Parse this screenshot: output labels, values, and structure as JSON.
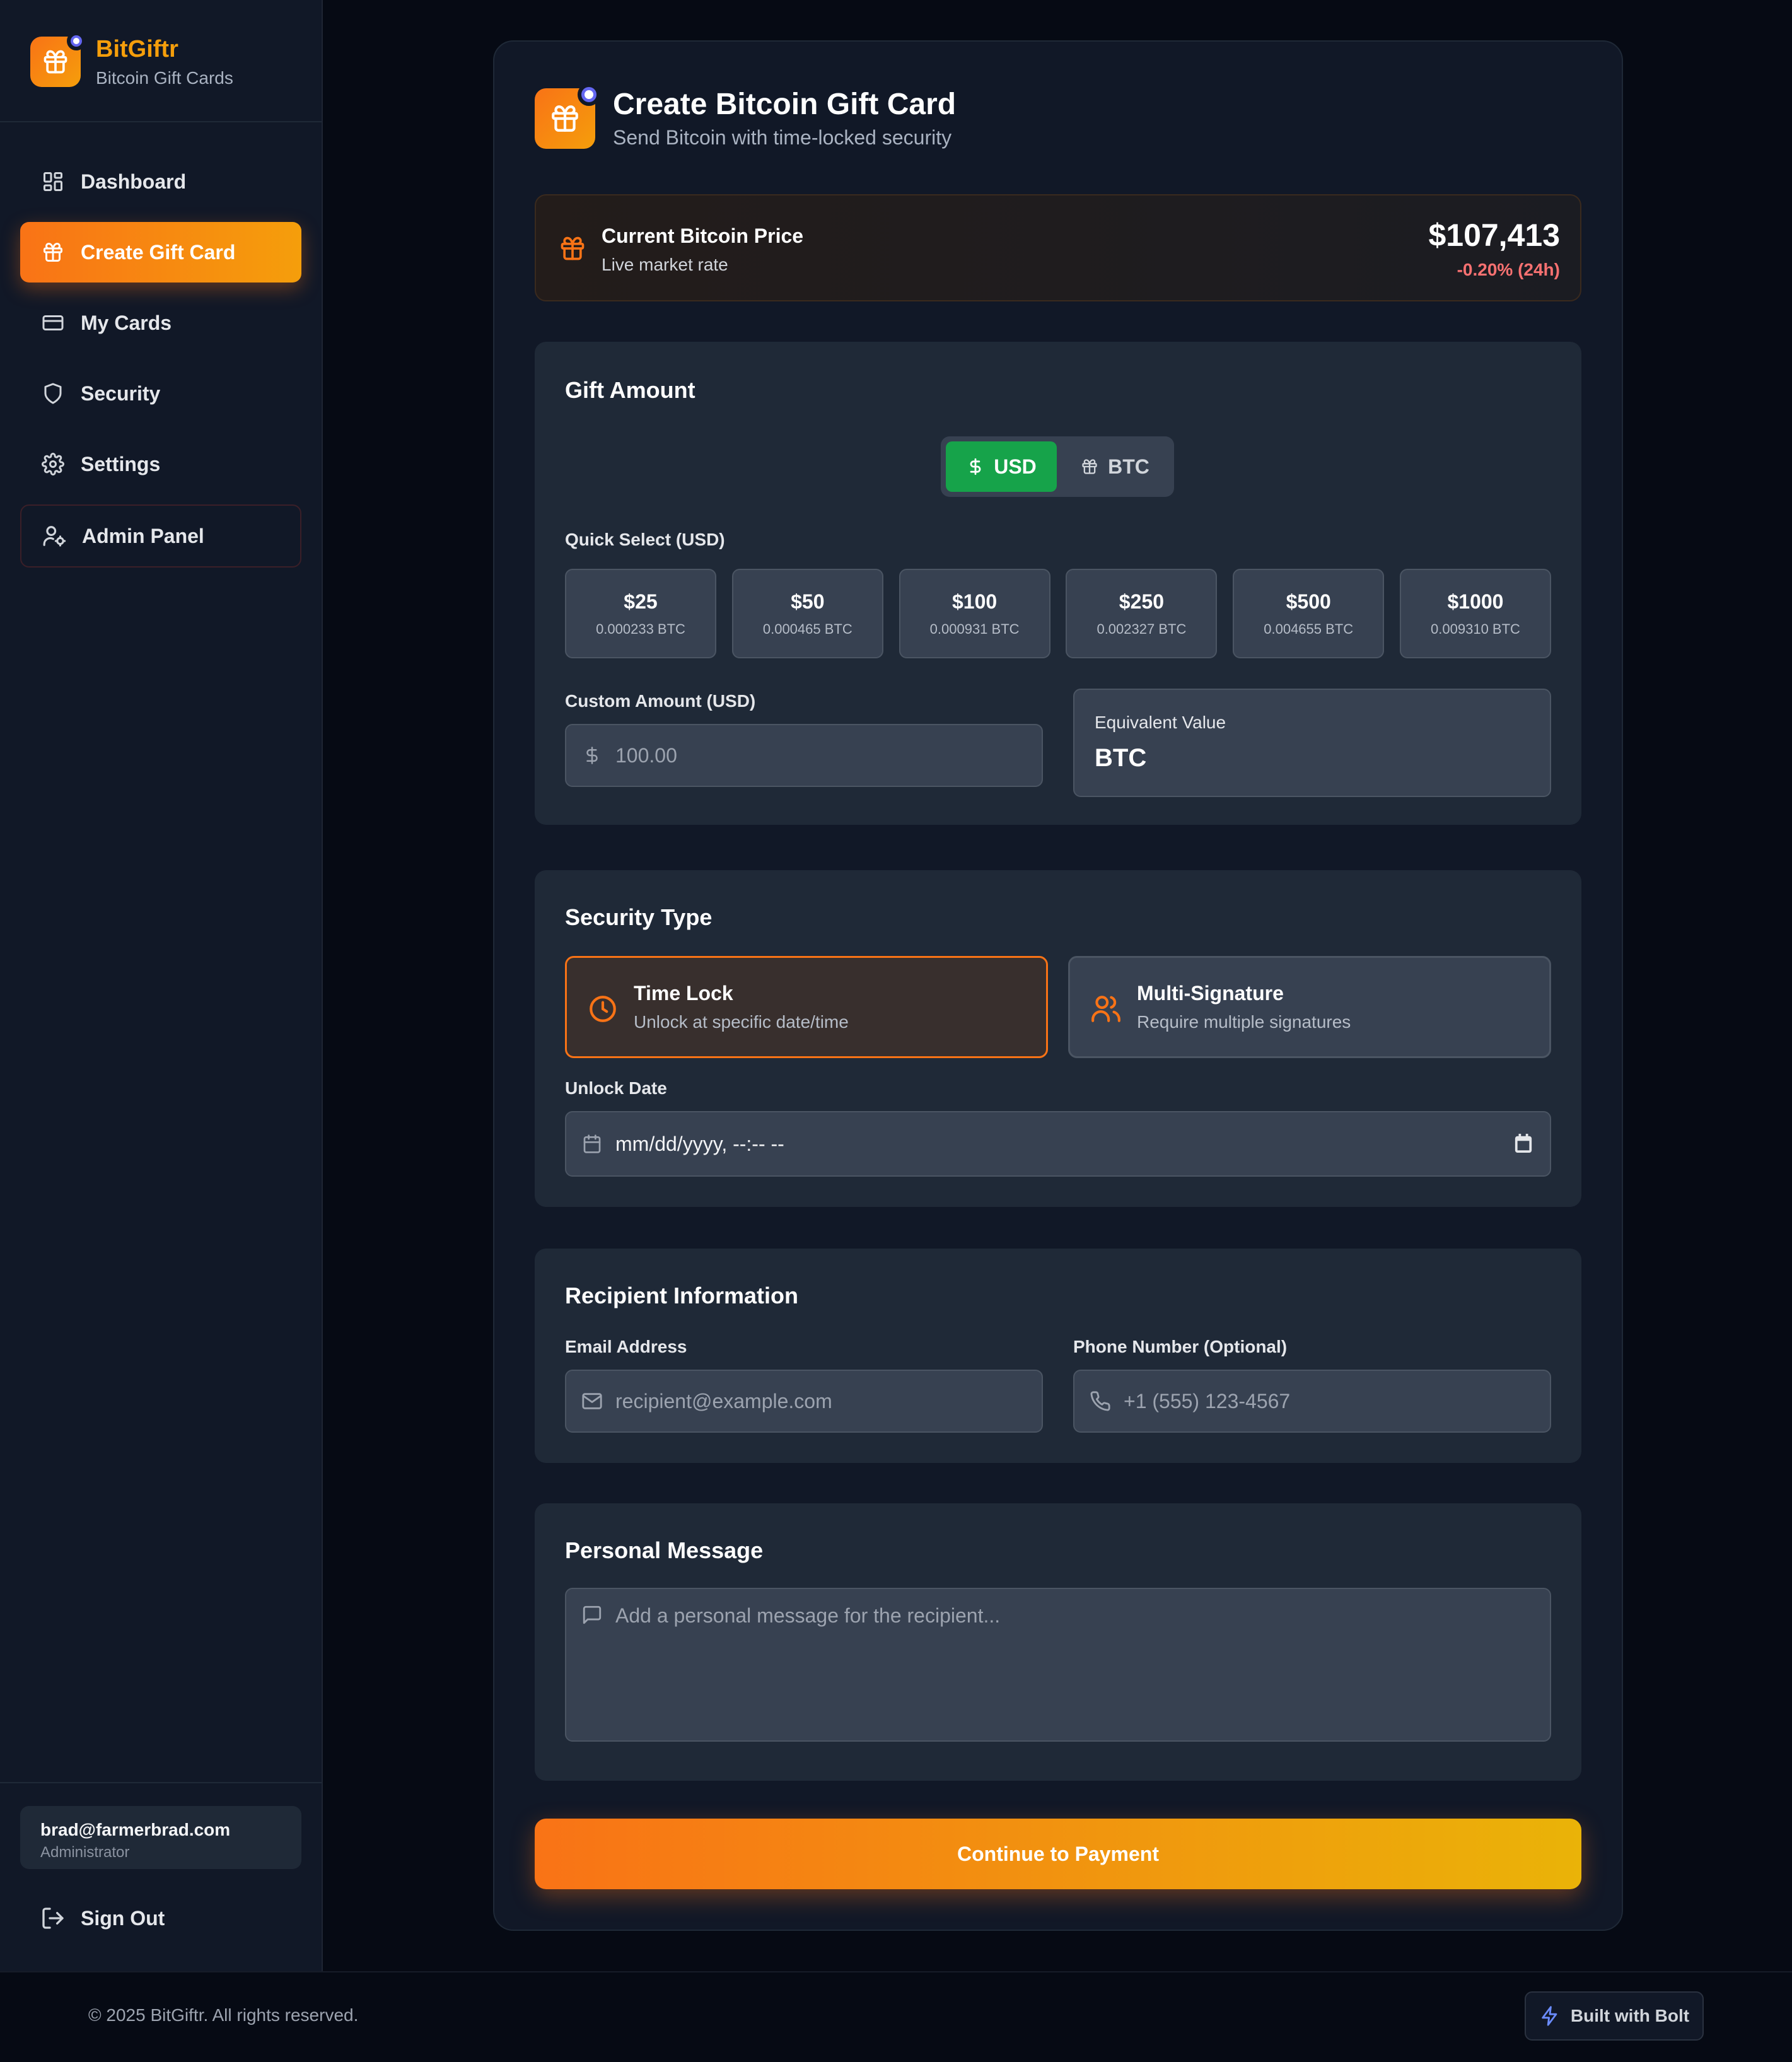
{
  "brand": {
    "name": "BitGiftr",
    "subtitle": "Bitcoin Gift Cards"
  },
  "nav": {
    "items": [
      {
        "label": "Dashboard",
        "icon": "dashboard-icon"
      },
      {
        "label": "Create Gift Card",
        "icon": "gift-icon",
        "active": true
      },
      {
        "label": "My Cards",
        "icon": "card-icon"
      },
      {
        "label": "Security",
        "icon": "shield-icon"
      },
      {
        "label": "Settings",
        "icon": "gear-icon"
      },
      {
        "label": "Admin Panel",
        "icon": "user-cog-icon"
      }
    ]
  },
  "user": {
    "email": "brad@farmerbrad.com",
    "role": "Administrator"
  },
  "signout": {
    "label": "Sign Out"
  },
  "header": {
    "title": "Create Bitcoin Gift Card",
    "subtitle": "Send Bitcoin with time-locked security"
  },
  "price": {
    "title": "Current Bitcoin Price",
    "subtitle": "Live market rate",
    "value": "$107,413",
    "change": "-0.20% (24h)"
  },
  "gift_amount": {
    "title": "Gift Amount",
    "toggle": {
      "usd": "USD",
      "btc": "BTC",
      "selected": "USD"
    },
    "quick_label": "Quick Select (USD)",
    "quick": [
      {
        "amount": "$25",
        "btc": "0.000233 BTC"
      },
      {
        "amount": "$50",
        "btc": "0.000465 BTC"
      },
      {
        "amount": "$100",
        "btc": "0.000931 BTC"
      },
      {
        "amount": "$250",
        "btc": "0.002327 BTC"
      },
      {
        "amount": "$500",
        "btc": "0.004655 BTC"
      },
      {
        "amount": "$1000",
        "btc": "0.009310 BTC"
      }
    ],
    "custom_label": "Custom Amount (USD)",
    "custom_placeholder": "100.00",
    "equiv_label": "Equivalent Value",
    "equiv_value": "BTC"
  },
  "security": {
    "title": "Security Type",
    "options": [
      {
        "title": "Time Lock",
        "subtitle": "Unlock at specific date/time",
        "selected": true
      },
      {
        "title": "Multi-Signature",
        "subtitle": "Require multiple signatures",
        "selected": false
      }
    ],
    "unlock_label": "Unlock Date",
    "unlock_value": "mm/dd/yyyy, --:-- --"
  },
  "recipient": {
    "title": "Recipient Information",
    "email_label": "Email Address",
    "email_placeholder": "recipient@example.com",
    "phone_label": "Phone Number (Optional)",
    "phone_placeholder": "+1 (555) 123-4567"
  },
  "message": {
    "title": "Personal Message",
    "placeholder": "Add a personal message for the recipient..."
  },
  "cta": {
    "label": "Continue to Payment"
  },
  "footer": {
    "copyright": "© 2025 BitGiftr. All rights reserved.",
    "badge": "Built with Bolt"
  },
  "colors": {
    "accent": "#f97316",
    "accent2": "#f59e0b",
    "success": "#16a34a",
    "negative": "#f87171",
    "background": "#060a14",
    "panel": "#111827"
  }
}
